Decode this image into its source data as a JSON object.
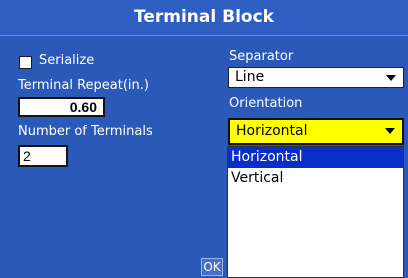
{
  "dialog": {
    "title": "Terminal Block",
    "ok_label": "OK"
  },
  "serialize": {
    "label": "Serialize",
    "checked": false
  },
  "terminal_repeat": {
    "label": "Terminal Repeat(in.)",
    "value": "0.60"
  },
  "number_of_terminals": {
    "label": "Number of Terminals",
    "value": "2"
  },
  "separator": {
    "label": "Separator",
    "selected": "Line"
  },
  "orientation": {
    "label": "Orientation",
    "selected": "Horizontal",
    "options": [
      "Horizontal",
      "Vertical"
    ]
  },
  "colors": {
    "dialog_bg": "#2b59b8",
    "highlight_yellow": "#ffff00",
    "selected_option": "#0a2fc9"
  }
}
